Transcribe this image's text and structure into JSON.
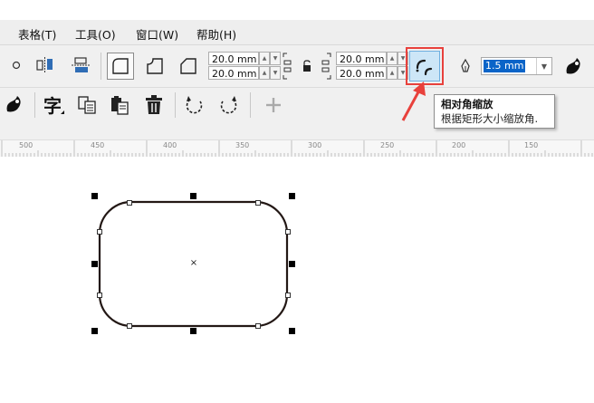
{
  "menu": {
    "items": [
      {
        "label": "表格(T)"
      },
      {
        "label": "工具(O)"
      },
      {
        "label": "窗口(W)"
      },
      {
        "label": "帮助(H)"
      }
    ]
  },
  "property_bar": {
    "corner_width_1": "20.0 mm",
    "corner_height_1": "20.0 mm",
    "corner_width_2": "20.0 mm",
    "corner_height_2": "20.0 mm",
    "outline_width": "1.5 mm"
  },
  "tooltip": {
    "title": "相对角缩放",
    "description": "根据矩形大小缩放角."
  },
  "ruler": {
    "labels": [
      "500",
      "450",
      "400",
      "350",
      "300",
      "250",
      "200",
      "150"
    ]
  },
  "icons": {
    "relative-corner-scale": "relative-corner-scale-icon",
    "pen": "pen-icon",
    "color": "color-eyedropper-icon",
    "text": "text-tool-icon",
    "undo": "undo-icon",
    "redo": "redo-icon",
    "add": "plus-icon"
  },
  "colors": {
    "highlight_border": "#e8413c",
    "selected_field": "#0a64c8",
    "shape_outline": "#231815"
  }
}
